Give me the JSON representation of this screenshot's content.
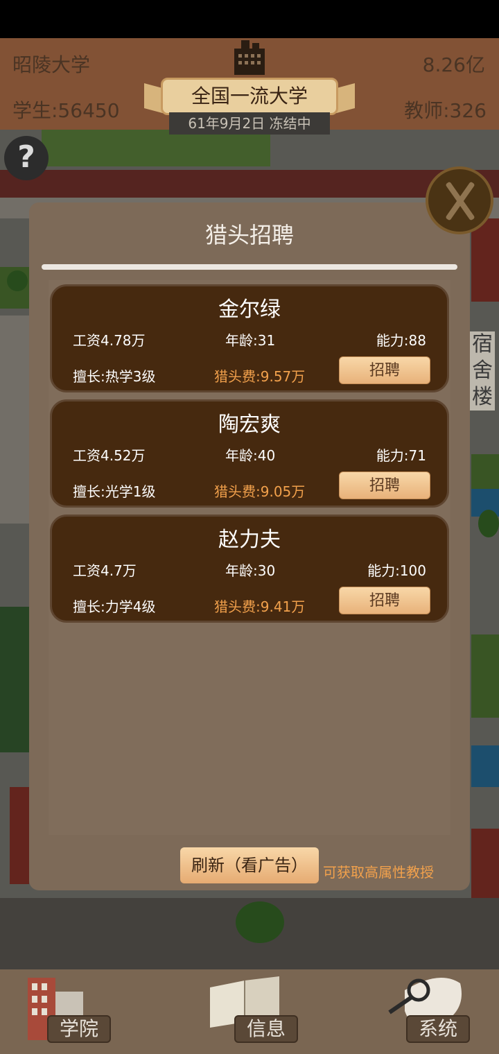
{
  "hud": {
    "campus_name": "昭陵大学",
    "funds": "8.26亿",
    "students": "学生:56450",
    "teachers": "教师:326",
    "rank": "全国一流大学",
    "date_status": "61年9月2日 冻结中"
  },
  "scene": {
    "help_glyph": "?",
    "dorm_label": "宿舍楼"
  },
  "dialog": {
    "title": "猎头招聘",
    "candidates": [
      {
        "name": "金尔绿",
        "salary": "工资4.78万",
        "age": "年龄:31",
        "ability": "能力:88",
        "specialty": "擅长:热学3级",
        "fee": "猎头费:9.57万",
        "hire_label": "招聘"
      },
      {
        "name": "陶宏爽",
        "salary": "工资4.52万",
        "age": "年龄:40",
        "ability": "能力:71",
        "specialty": "擅长:光学1级",
        "fee": "猎头费:9.05万",
        "hire_label": "招聘"
      },
      {
        "name": "赵力夫",
        "salary": "工资4.7万",
        "age": "年龄:30",
        "ability": "能力:100",
        "specialty": "擅长:力学4级",
        "fee": "猎头费:9.41万",
        "hire_label": "招聘"
      }
    ],
    "refresh_label": "刷新（看广告）",
    "refresh_hint": "可获取高属性教授"
  },
  "nav": {
    "items": [
      {
        "label": "学院",
        "icon": "college-building-icon"
      },
      {
        "label": "信息",
        "icon": "book-icon"
      },
      {
        "label": "系统",
        "icon": "magnifier-icon"
      }
    ]
  },
  "colors": {
    "dialog_bg": "#7d6a58",
    "card_bg": "#46290f",
    "accent_orange": "#f2a14c",
    "button_light": "#f8d7a8"
  }
}
